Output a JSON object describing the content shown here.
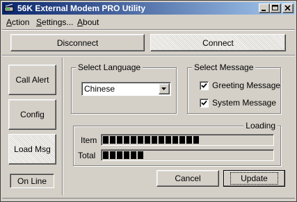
{
  "window": {
    "title": "56K External Modem PRO Utility",
    "title_icon": "modem-app-icon"
  },
  "menu": [
    {
      "label": "Action",
      "underline": "A",
      "rest": "ction"
    },
    {
      "label": "Settings...",
      "underline": "S",
      "rest": "ettings..."
    },
    {
      "label": "About",
      "underline": "A",
      "rest": "bout"
    }
  ],
  "connection": {
    "disconnect_label": "Disconnect",
    "connect_label": "Connect"
  },
  "sidebar": {
    "call_alert_label": "Call Alert",
    "config_label": "Config",
    "load_msg_label": "Load Msg",
    "status_label": "On Line"
  },
  "language": {
    "group_label": "Select Language",
    "selected": "Chinese"
  },
  "message": {
    "group_label": "Select Message",
    "greeting_label": "Greeting Message",
    "greeting_checked": true,
    "system_label": "System Message",
    "system_checked": true
  },
  "loading": {
    "group_label": "Loading",
    "item_label": "Item",
    "item_progress": 0.58,
    "total_label": "Total",
    "total_progress": 0.26
  },
  "actions": {
    "cancel_label": "Cancel",
    "update_label": "Update"
  }
}
